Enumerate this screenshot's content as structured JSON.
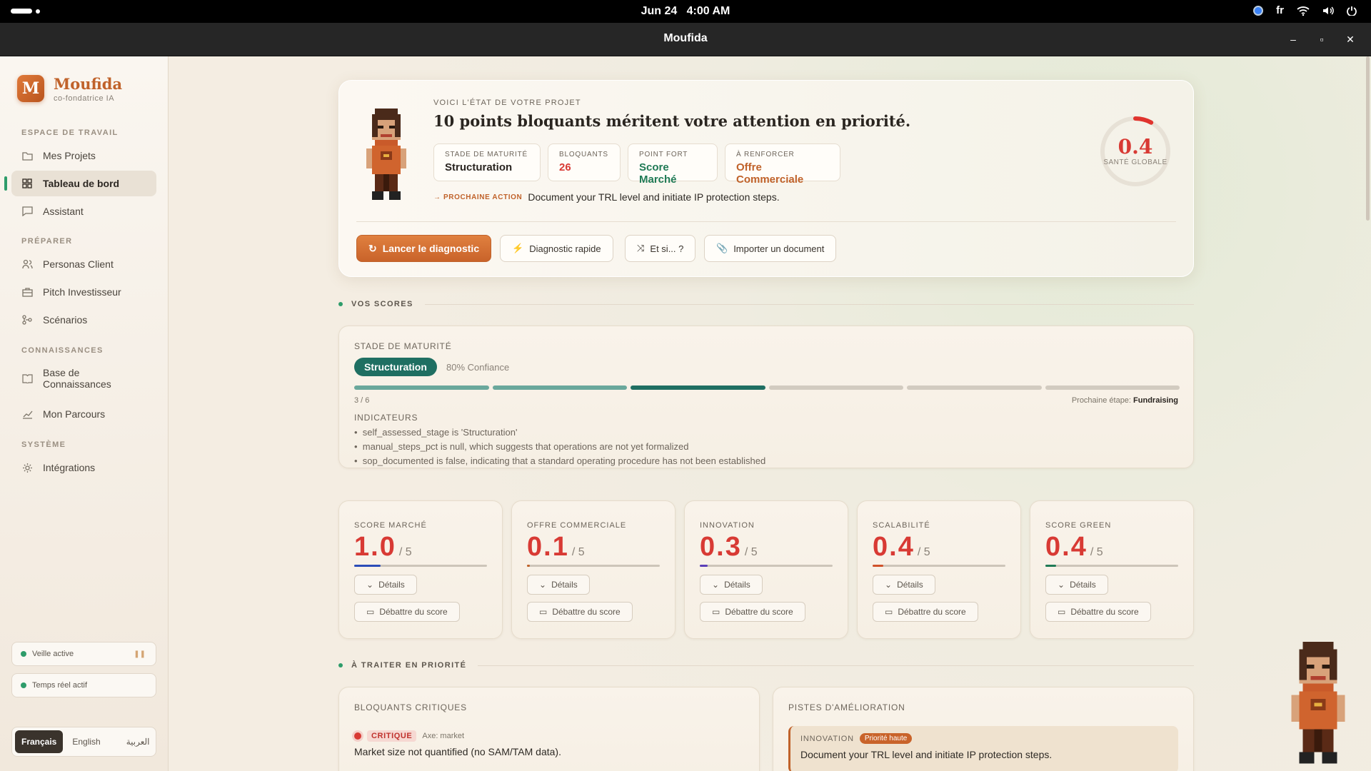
{
  "system": {
    "date": "Jun 24",
    "time": "4:00 AM",
    "input_lang": "fr"
  },
  "window": {
    "title": "Moufida",
    "minimize": "–",
    "maximize": "▫",
    "close": "✕"
  },
  "sidebar": {
    "brand": "Moufida",
    "brand_initial": "M",
    "brand_sub": "co-fondatrice IA",
    "sections": {
      "workspace": "ESPACE DE TRAVAIL",
      "prepare": "PRÉPARER",
      "knowledge": "CONNAISSANCES",
      "system": "SYSTÈME"
    },
    "items": {
      "projects": "Mes Projets",
      "dashboard": "Tableau de bord",
      "assistant": "Assistant",
      "personas": "Personas Client",
      "pitch": "Pitch Investisseur",
      "scenarios": "Scénarios",
      "kb": "Base de Connaissances",
      "journey": "Mon Parcours",
      "integrations": "Intégrations"
    },
    "status1": "Veille active",
    "status2": "Temps réel actif",
    "langs": [
      "Français",
      "English",
      "العربية"
    ]
  },
  "hero": {
    "kicker": "VOICI L'ÉTAT DE VOTRE PROJET",
    "title": "10 points bloquants méritent votre attention en priorité.",
    "chips": [
      {
        "label": "STADE DE MATURITÉ",
        "value": "Structuration",
        "color": "#2a2520"
      },
      {
        "label": "BLOQUANTS",
        "value": "26",
        "color": "#d83a34"
      },
      {
        "label": "POINT FORT",
        "value": "Score Marché",
        "color": "#1f7a55"
      },
      {
        "label": "À RENFORCER",
        "value": "Offre Commerciale",
        "color": "#c0622a"
      }
    ],
    "next_label": "→ PROCHAINE ACTION",
    "next_text": "Document your TRL level and initiate IP protection steps.",
    "gauge_value": "0.4",
    "gauge_label": "SANTÉ GLOBALE",
    "gauge_fraction": 0.08,
    "buttons": {
      "diagnostic": "Lancer le diagnostic",
      "quick": "Diagnostic rapide",
      "whatif": "Et si... ?",
      "import": "Importer un document"
    }
  },
  "scores_section": "VOS SCORES",
  "maturity": {
    "title": "STADE DE MATURITÉ",
    "stage": "Structuration",
    "confidence": "80% Confiance",
    "step": "3 / 6",
    "current_step": 3,
    "total_steps": 6,
    "next_label": "Prochaine étape:",
    "next_stage": "Fundraising",
    "indicators_title": "INDICATEURS",
    "indicators": [
      "self_assessed_stage is 'Structuration'",
      "manual_steps_pct is null, which suggests that operations are not yet formalized",
      "sop_documented is false, indicating that a standard operating procedure has not been established"
    ]
  },
  "scores": [
    {
      "label": "SCORE MARCHÉ",
      "value": "1.0",
      "max": "/ 5",
      "fraction": 0.2,
      "color": "#2b4db8"
    },
    {
      "label": "OFFRE COMMERCIALE",
      "value": "0.1",
      "max": "/ 5",
      "fraction": 0.02,
      "color": "#c0622a"
    },
    {
      "label": "INNOVATION",
      "value": "0.3",
      "max": "/ 5",
      "fraction": 0.06,
      "color": "#5b3fb8"
    },
    {
      "label": "SCALABILITÉ",
      "value": "0.4",
      "max": "/ 5",
      "fraction": 0.08,
      "color": "#d0522a"
    },
    {
      "label": "SCORE GREEN",
      "value": "0.4",
      "max": "/ 5",
      "fraction": 0.08,
      "color": "#1f7a55"
    }
  ],
  "score_buttons": {
    "details": "Détails",
    "debate": "Débattre du score"
  },
  "priority_section": "À TRAITER EN PRIORITÉ",
  "blockers": {
    "title": "BLOQUANTS CRITIQUES",
    "tag": "CRITIQUE",
    "axis": "Axe: market",
    "text": "Market size not quantified (no SAM/TAM data)."
  },
  "improvements": {
    "title": "PISTES D'AMÉLIORATION",
    "axis": "INNOVATION",
    "badge": "Priorité haute",
    "text": "Document your TRL level and initiate IP protection steps."
  }
}
